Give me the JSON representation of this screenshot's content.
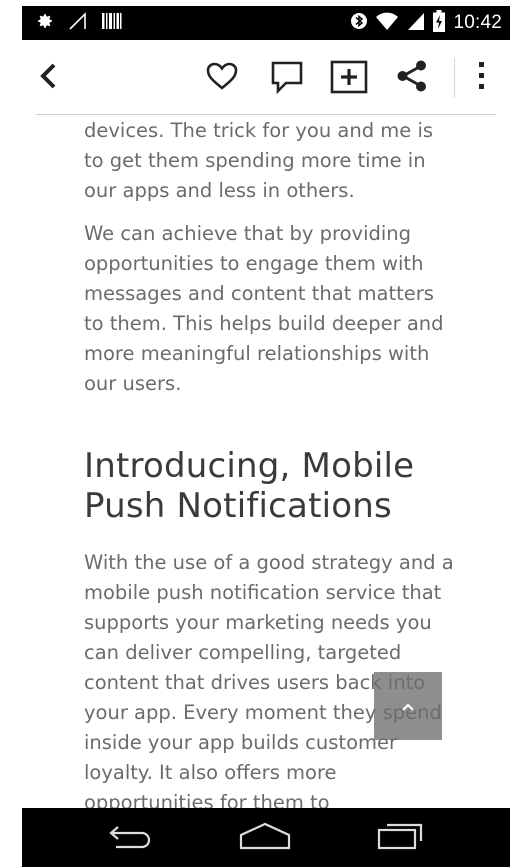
{
  "status_bar": {
    "time": "10:42",
    "icons_left": [
      "settings-icon",
      "signal-off-icon",
      "barcode-icon"
    ],
    "icons_right": [
      "bluetooth-icon",
      "wifi-icon",
      "cell-signal-icon",
      "battery-charging-icon"
    ]
  },
  "toolbar": {
    "icons": [
      "back-icon",
      "heart-icon",
      "comment-icon",
      "add-box-icon",
      "share-icon",
      "more-vert-icon"
    ]
  },
  "article": {
    "paragraphs_top": [
      "devices. The trick for you and me is to get them spending more time in our apps and less in others.",
      "We can achieve that by providing opportunities to engage them with messages and content that matters to them. This helps build deeper and more meaningful relationships with our users."
    ],
    "heading": "Introducing, Mobile Push Notifications",
    "paragraph_bottom": "With the use of a good strategy and a mobile push notification service that supports your marketing needs you can deliver compelling, targeted content that drives users back into your app. Every moment they spend inside your app builds customer loyalty. It also offers more opportunities for them to"
  },
  "scroll_top": {
    "icon": "chevron-up-icon"
  },
  "nav_bar": {
    "icons": [
      "nav-back-icon",
      "nav-home-icon",
      "nav-recents-icon"
    ]
  }
}
